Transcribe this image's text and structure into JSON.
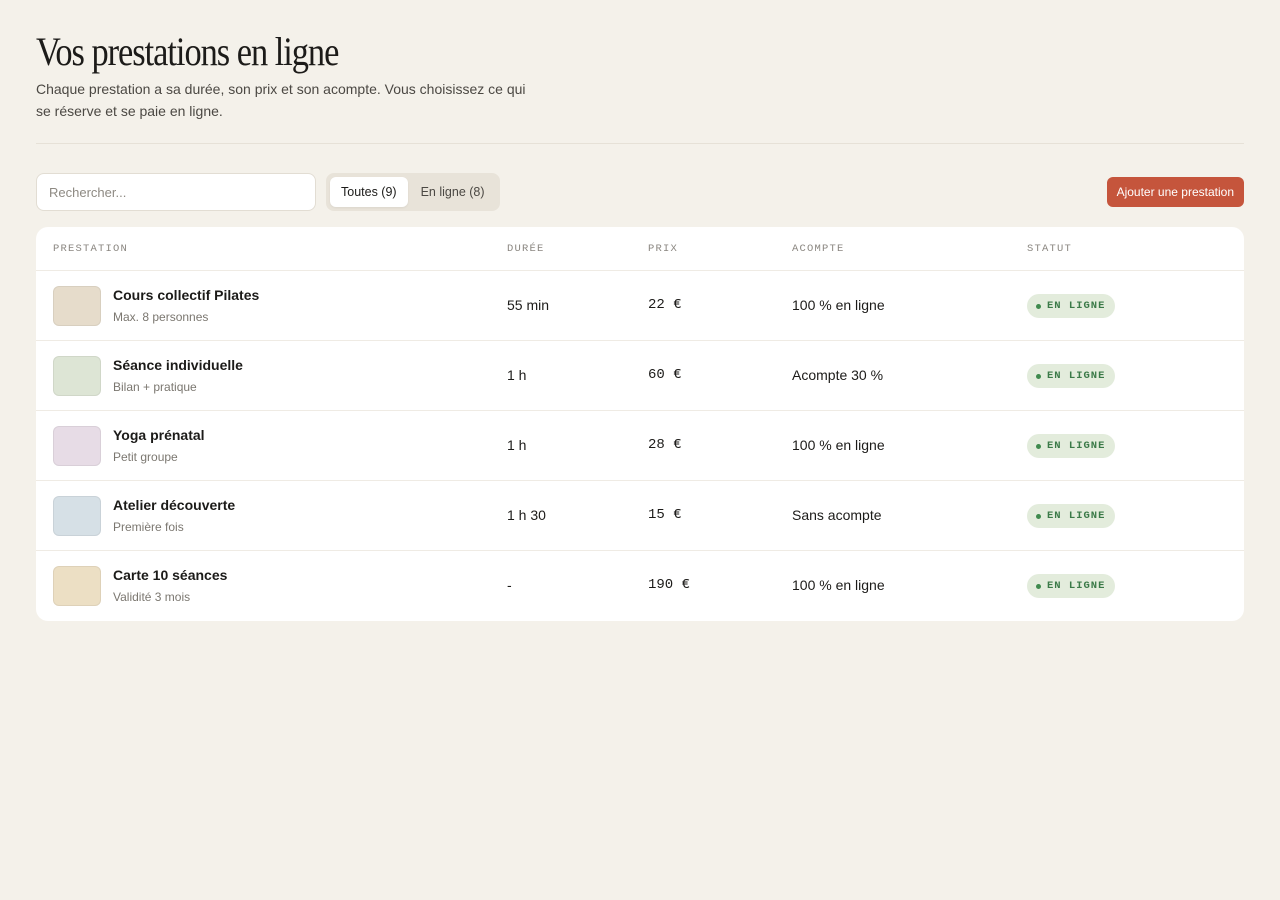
{
  "header": {
    "title": "Vos prestations en ligne",
    "subtitle": "Chaque prestation a sa durée, son prix et son acompte. Vous choisissez ce qui se réserve et se paie en ligne."
  },
  "toolbar": {
    "search_placeholder": "Rechercher...",
    "tabs": [
      {
        "label": "Toutes (9)",
        "active": true
      },
      {
        "label": "En ligne (8)",
        "active": false
      }
    ],
    "add_label": "Ajouter une prestation"
  },
  "colors": {
    "accent": "#c5553c",
    "background": "#f4f1ea",
    "status_bg": "#e3ecdc",
    "status_text": "#3b7a48"
  },
  "table": {
    "columns": {
      "service": "PRESTATION",
      "duration": "DURÉE",
      "price": "PRIX",
      "deposit": "ACOMPTE",
      "status": "STATUT"
    },
    "rows": [
      {
        "name": "Cours collectif Pilates",
        "sub": "Max. 8 personnes",
        "duration": "55 min",
        "price": "22 €",
        "deposit": "100 % en ligne",
        "status": "EN LIGNE",
        "thumb_color": "#e6dccb"
      },
      {
        "name": "Séance individuelle",
        "sub": "Bilan + pratique",
        "duration": "1 h",
        "price": "60 €",
        "deposit": "Acompte 30 %",
        "status": "EN LIGNE",
        "thumb_color": "#dde5d5"
      },
      {
        "name": "Yoga prénatal",
        "sub": "Petit groupe",
        "duration": "1 h",
        "price": "28 €",
        "deposit": "100 % en ligne",
        "status": "EN LIGNE",
        "thumb_color": "#e7dce6"
      },
      {
        "name": "Atelier découverte",
        "sub": "Première fois",
        "duration": "1 h 30",
        "price": "15 €",
        "deposit": "Sans acompte",
        "status": "EN LIGNE",
        "thumb_color": "#d6e0e6"
      },
      {
        "name": "Carte 10 séances",
        "sub": "Validité 3 mois",
        "duration": "-",
        "price": "190 €",
        "deposit": "100 % en ligne",
        "status": "EN LIGNE",
        "thumb_color": "#ecdfc4"
      }
    ]
  }
}
